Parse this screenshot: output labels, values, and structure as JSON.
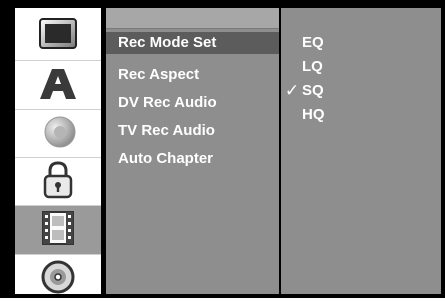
{
  "sidebar": {
    "icons": [
      {
        "name": "tv-icon"
      },
      {
        "name": "language-icon",
        "glyph": "A"
      },
      {
        "name": "audio-icon"
      },
      {
        "name": "lock-icon"
      },
      {
        "name": "film-icon",
        "active": true
      },
      {
        "name": "disc-icon"
      }
    ]
  },
  "menu": {
    "items": [
      {
        "label": "Rec Mode Set",
        "selected": true
      },
      {
        "label": "Rec Aspect"
      },
      {
        "label": "DV Rec Audio"
      },
      {
        "label": "TV Rec Audio"
      },
      {
        "label": "Auto Chapter"
      }
    ]
  },
  "options": {
    "items": [
      {
        "label": "EQ"
      },
      {
        "label": "LQ"
      },
      {
        "label": "SQ",
        "checked": true
      },
      {
        "label": "HQ"
      }
    ],
    "check_glyph": "✓"
  },
  "colors": {
    "panel": "#8e8e8e",
    "selected_item": "#5c5c5c",
    "active_icon": "#9a9a9a",
    "text": "#ffffff"
  }
}
